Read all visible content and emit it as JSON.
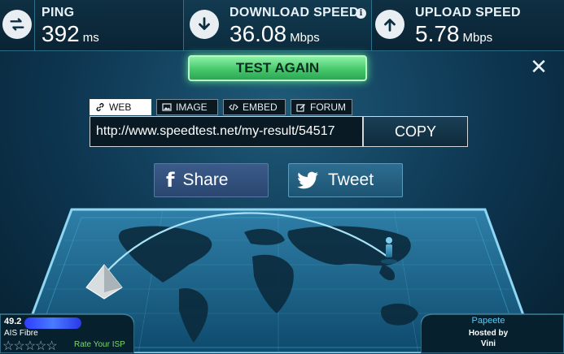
{
  "stats": {
    "ping": {
      "label": "PING",
      "value": "392",
      "unit": "ms",
      "icon": "exchange-arrows-icon"
    },
    "download": {
      "label": "DOWNLOAD SPEED",
      "value": "36.08",
      "unit": "Mbps",
      "icon": "arrow-down-icon"
    },
    "upload": {
      "label": "UPLOAD SPEED",
      "value": "5.78",
      "unit": "Mbps",
      "icon": "arrow-up-icon"
    },
    "info_glyph": "i"
  },
  "actions": {
    "test_again": "TEST AGAIN",
    "close": "✕"
  },
  "share_tabs": [
    {
      "label": "WEB",
      "icon": "link-icon"
    },
    {
      "label": "IMAGE",
      "icon": "image-icon"
    },
    {
      "label": "EMBED",
      "icon": "code-icon"
    },
    {
      "label": "FORUM",
      "icon": "edit-icon"
    }
  ],
  "result": {
    "url": "http://www.speedtest.net/my-result/54517",
    "copy_label": "COPY"
  },
  "social": {
    "share_label": "Share",
    "tweet_label": "Tweet",
    "share_icon": "f"
  },
  "isp": {
    "ip_prefix": "49.2",
    "name": "AIS Fibre",
    "stars": "☆☆☆☆☆",
    "rate_label": "Rate Your ISP"
  },
  "server": {
    "city": "Papeete",
    "hosted_by_label": "Hosted by",
    "host": "Vini"
  },
  "colors": {
    "accent_green": "#45c86a",
    "panel_blue": "#0d3550",
    "city_blue": "#5ec8f0"
  }
}
